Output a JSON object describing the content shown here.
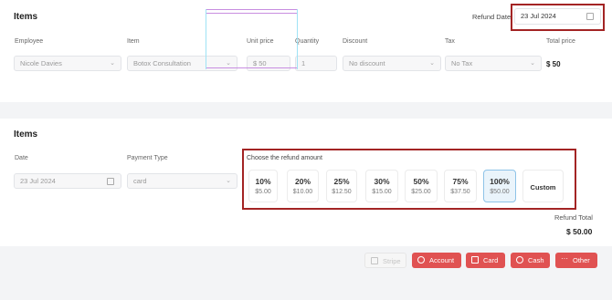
{
  "items_section": {
    "title": "Items",
    "refund_date_label": "Refund Date",
    "refund_date_value": "23 Jul 2024",
    "columns": [
      "Employee",
      "Item",
      "Unit price",
      "Quantity",
      "Discount",
      "Tax",
      "Total price"
    ],
    "row": {
      "employee": "Nicole  Davies",
      "item": "Botox Consultation",
      "currency_symbol": "$",
      "unit_price": "50",
      "quantity": "1",
      "discount": "No discount",
      "tax": "No Tax",
      "total": "$ 50"
    }
  },
  "refund_section": {
    "title": "Items",
    "date_label": "Date",
    "date_value": "23 Jul 2024",
    "payment_type_label": "Payment Type",
    "payment_type_value": "card",
    "choose_label": "Choose the refund amount",
    "options": [
      {
        "pct": "10%",
        "amt": "$5.00"
      },
      {
        "pct": "20%",
        "amt": "$10.00"
      },
      {
        "pct": "25%",
        "amt": "$12.50"
      },
      {
        "pct": "30%",
        "amt": "$15.00"
      },
      {
        "pct": "50%",
        "amt": "$25.00"
      },
      {
        "pct": "75%",
        "amt": "$37.50"
      },
      {
        "pct": "100%",
        "amt": "$50.00"
      }
    ],
    "custom_label": "Custom",
    "selected_option": "100%",
    "refund_total_label": "Refund Total",
    "refund_total_value": "$ 50.00"
  },
  "actions": {
    "stripe": "Stripe",
    "account": "Account",
    "card": "Card",
    "cash": "Cash",
    "other": "Other"
  },
  "colors": {
    "accent": "#e05252",
    "highlight": "#a32424",
    "selected_bg": "#eaf4fb"
  }
}
